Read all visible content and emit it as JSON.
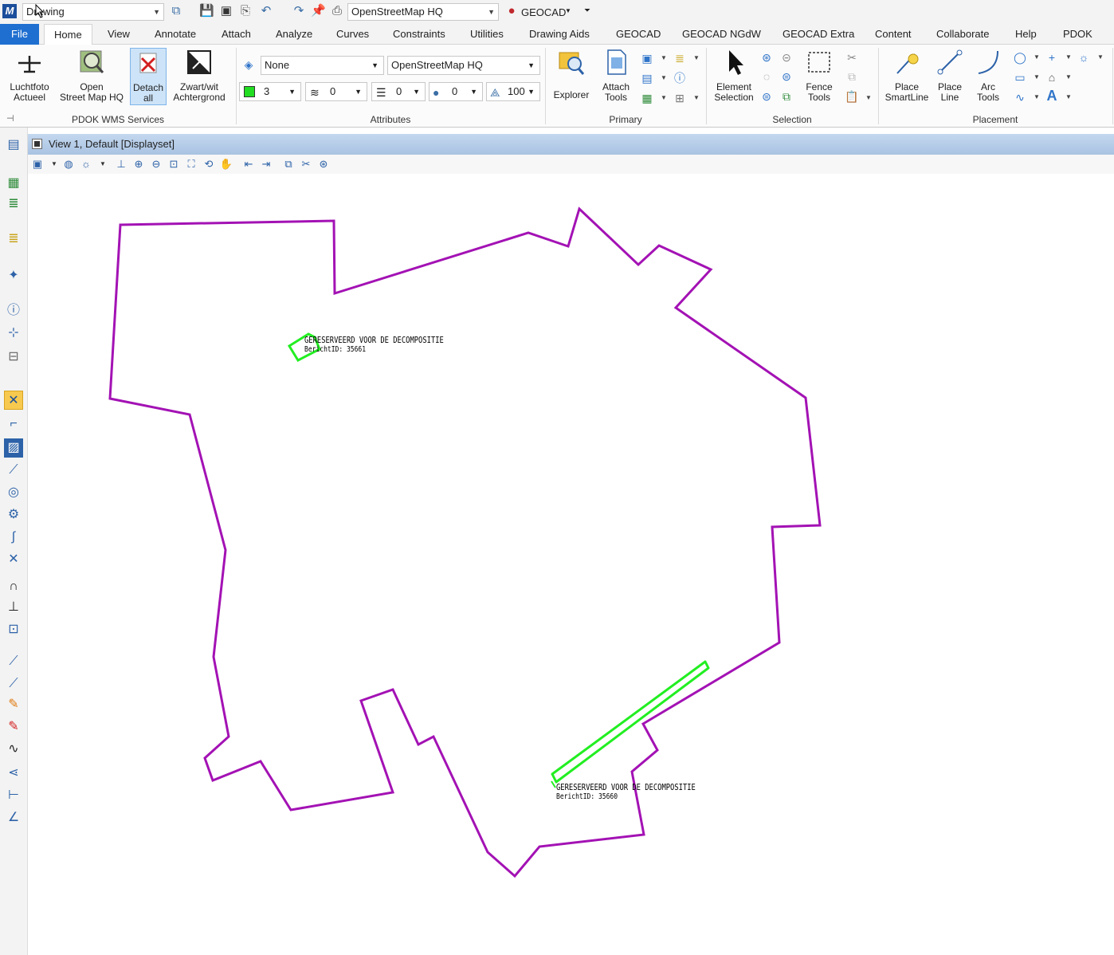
{
  "qat": {
    "app_logo": "M",
    "workflow": "Drawing",
    "model_dropdown": "OpenStreetMap HQ",
    "geocad_label": "GEOCAD",
    "icons": [
      "view-toggle-icon",
      "save-icon",
      "save-settings-icon",
      "compress-icon",
      "undo-icon",
      "redo-icon",
      "pin-icon",
      "print-icon",
      "geocad-logo-icon",
      "customize-icon"
    ]
  },
  "tabs": [
    "File",
    "Home",
    "View",
    "Annotate",
    "Attach",
    "Analyze",
    "Curves",
    "Constraints",
    "Utilities",
    "Drawing Aids",
    "GEOCAD",
    "GEOCAD NGdW",
    "GEOCAD Extra",
    "Content",
    "Collaborate",
    "Help",
    "PDOK"
  ],
  "active_tab": "Home",
  "ribbon": {
    "pdok": {
      "label": "PDOK WMS Services",
      "buttons": [
        {
          "line1": "Luchtfoto",
          "line2": "Actueel",
          "icon": "airplane-icon"
        },
        {
          "line1": "Open",
          "line2": "Street Map HQ",
          "icon": "map-magnifier-icon"
        },
        {
          "line1": "Detach",
          "line2": "all",
          "icon": "detach-x-icon"
        },
        {
          "line1": "Zwart/wit",
          "line2": "Achtergrond",
          "icon": "black-white-arrow-icon"
        }
      ]
    },
    "attributes": {
      "label": "Attributes",
      "level_value": "None",
      "model_value": "OpenStreetMap HQ",
      "color_value": "3",
      "color_hex": "#22dd22",
      "style_value": "0",
      "weight_value": "0",
      "transparency_value": "0",
      "priority_value": "100"
    },
    "primary": {
      "label": "Primary",
      "explorer": "Explorer",
      "attach_line1": "Attach",
      "attach_line2": "Tools"
    },
    "selection": {
      "label": "Selection",
      "element_line1": "Element",
      "element_line2": "Selection",
      "fence_line1": "Fence",
      "fence_line2": "Tools"
    },
    "placement": {
      "label": "Placement",
      "smartline_line1": "Place",
      "smartline_line2": "SmartLine",
      "line_line1": "Place",
      "line_line2": "Line",
      "arc_line1": "Arc",
      "arc_line2": "Tools"
    }
  },
  "view": {
    "title": "View 1, Default [Displayset]"
  },
  "drawing": {
    "boundary_color": "#a312b4",
    "highlight_color": "#22ee22",
    "annotations": [
      {
        "title": "GERESERVEERD VOOR DE DECOMPOSITIE",
        "sub": "BerichtID: 35661"
      },
      {
        "title": "GERESERVEERD VOOR DE DECOMPOSITIE",
        "sub": "BerichtID: 35660"
      }
    ]
  }
}
